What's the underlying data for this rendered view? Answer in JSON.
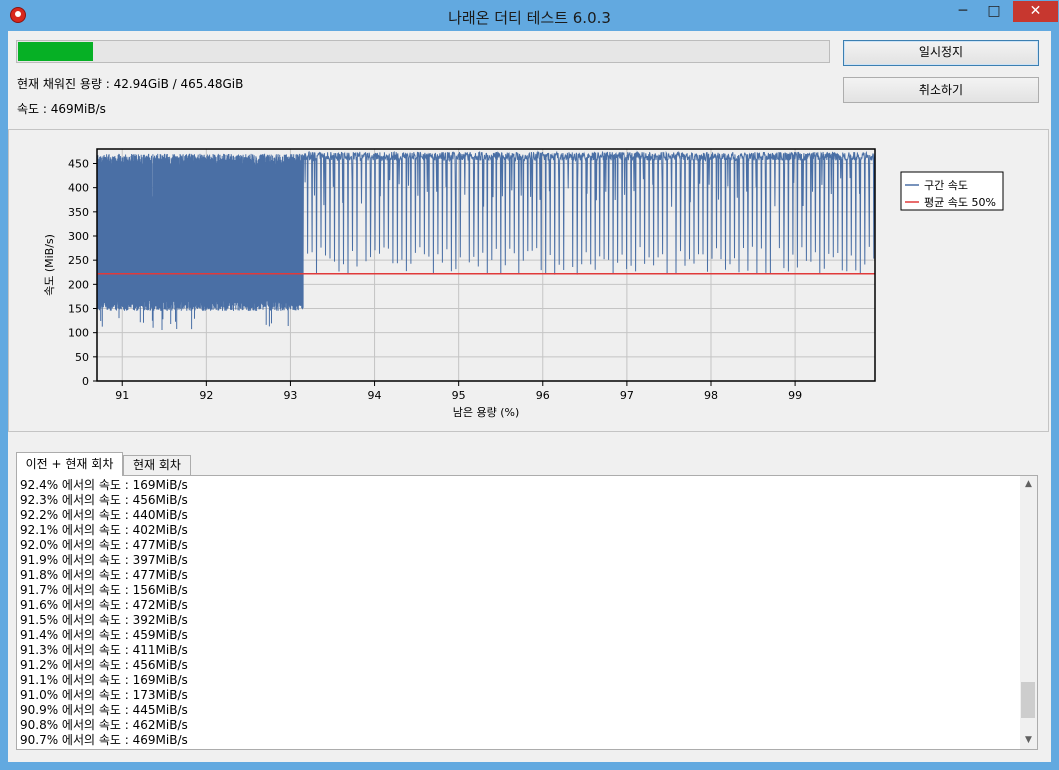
{
  "window": {
    "title": "나래온 더티 테스트 6.0.3",
    "icon": "app-logo-icon",
    "controls": {
      "minimize": "─",
      "maximize": "□",
      "close": "✕"
    }
  },
  "progress": {
    "fraction": 0.0922,
    "color": "#06b025"
  },
  "status": {
    "capacity": "현재 채워진 용량 : 42.94GiB / 465.48GiB",
    "speed": "속도 : 469MiB/s"
  },
  "buttons": {
    "pause": "일시정지",
    "cancel": "취소하기"
  },
  "chart_data": {
    "type": "line",
    "xlabel": "남은 용량 (%)",
    "ylabel": "속도 (MiB/s)",
    "xlim": [
      90.7,
      99.95
    ],
    "ylim": [
      0,
      480
    ],
    "x_ticks": [
      "91",
      "92",
      "93",
      "94",
      "95",
      "96",
      "97",
      "98",
      "99"
    ],
    "y_ticks": [
      "0",
      "50",
      "100",
      "150",
      "200",
      "250",
      "300",
      "350",
      "400",
      "450"
    ],
    "grid": true,
    "legend_placement": "right",
    "series": [
      {
        "name": "구간 속도",
        "color": "#4a6fa5",
        "segments": [
          {
            "x_range": [
              90.7,
              93.15
            ],
            "mode": "band",
            "low": 170,
            "high": 470
          },
          {
            "x_range": [
              93.15,
              99.95
            ],
            "mode": "line",
            "base": 474,
            "dips_to": 220
          }
        ]
      },
      {
        "name": "평균 속도 50%",
        "color": "#e03a3a",
        "values": [
          222,
          222
        ]
      }
    ]
  },
  "tabs": [
    "이전 + 현재 회차",
    "현재 회차"
  ],
  "log": {
    "lines": [
      "92.4% 에서의 속도 : 169MiB/s",
      "92.3% 에서의 속도 : 456MiB/s",
      "92.2% 에서의 속도 : 440MiB/s",
      "92.1% 에서의 속도 : 402MiB/s",
      "92.0% 에서의 속도 : 477MiB/s",
      "91.9% 에서의 속도 : 397MiB/s",
      "91.8% 에서의 속도 : 477MiB/s",
      "91.7% 에서의 속도 : 156MiB/s",
      "91.6% 에서의 속도 : 472MiB/s",
      "91.5% 에서의 속도 : 392MiB/s",
      "91.4% 에서의 속도 : 459MiB/s",
      "91.3% 에서의 속도 : 411MiB/s",
      "91.2% 에서의 속도 : 456MiB/s",
      "91.1% 에서의 속도 : 169MiB/s",
      "91.0% 에서의 속도 : 173MiB/s",
      "90.9% 에서의 속도 : 445MiB/s",
      "90.8% 에서의 속도 : 462MiB/s",
      "90.7% 에서의 속도 : 469MiB/s"
    ],
    "scroll_position": 0.93,
    "scroll_visible_fraction": 0.15
  }
}
